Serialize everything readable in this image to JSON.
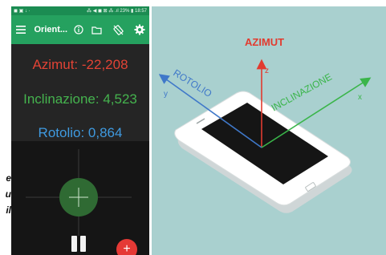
{
  "side_caption": [
    "e",
    "u",
    "il"
  ],
  "phone": {
    "status_bar": {
      "left": "◼ ▣ ↓ ·",
      "right": "⁂ ◀ ◼ ⊠ ⁂ .ıl 23% ▮ 18:57"
    },
    "app_bar": {
      "menu_icon": "hamburger-menu-icon",
      "title": "Orient...",
      "actions": [
        "info-icon",
        "folder-icon",
        "rotation-lock-icon",
        "settings-gear-icon"
      ]
    },
    "readings": {
      "azimut": "Azimut: -22,208",
      "inclinazione": "Inclinazione: 4,523",
      "rotolio": "Rotolio: 0,864"
    },
    "bubble_level": {
      "offset_x": 0,
      "offset_y": 0
    },
    "pause_icon": "pause-icon",
    "fab_label": "+"
  },
  "illustration": {
    "azimut_label": "AZIMUT",
    "z_label": "z",
    "rotolio_label": "ROTOLIO",
    "y_label": "y",
    "inclinazione_label": "INCLINAZIONE",
    "x_label": "x",
    "colors": {
      "azimut": "#e23b2f",
      "rotolio": "#3f78c9",
      "inclinazione": "#3ab54a",
      "background": "#a9d0cf"
    }
  }
}
